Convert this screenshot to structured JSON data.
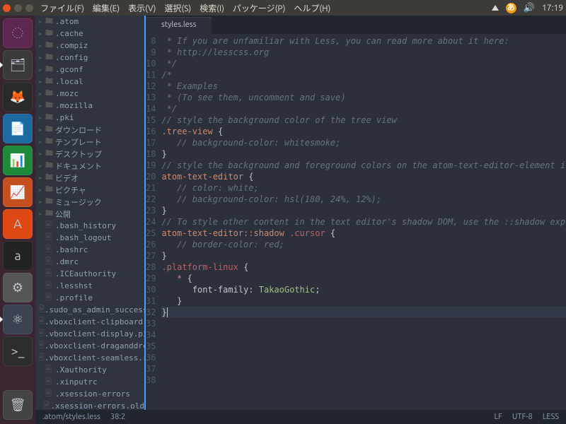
{
  "topbar": {
    "menu": [
      "ファイル(F)",
      "編集(E)",
      "表示(V)",
      "選択(S)",
      "検索(I)",
      "パッケージ(P)",
      "ヘルプ(H)"
    ],
    "input_badge": "あ",
    "time": "17:19"
  },
  "launcher": [
    {
      "name": "dash",
      "bg": "#5e2750",
      "glyph": "◌",
      "active": false
    },
    {
      "name": "files",
      "bg": "#3a3a3a",
      "glyph": "🗂",
      "active": true
    },
    {
      "name": "firefox",
      "bg": "#2a2a2a",
      "glyph": "🦊",
      "active": false
    },
    {
      "name": "writer",
      "bg": "#1c6aa0",
      "glyph": "📄",
      "active": false
    },
    {
      "name": "calc",
      "bg": "#1d8a3a",
      "glyph": "📊",
      "active": false
    },
    {
      "name": "impress",
      "bg": "#c54f1e",
      "glyph": "📈",
      "active": false
    },
    {
      "name": "software",
      "bg": "#dd4814",
      "glyph": "A",
      "active": false
    },
    {
      "name": "amazon",
      "bg": "#222",
      "glyph": "a",
      "active": false
    },
    {
      "name": "settings",
      "bg": "#555",
      "glyph": "⚙",
      "active": false
    },
    {
      "name": "atom",
      "bg": "#3b4252",
      "glyph": "⚛",
      "active": true
    },
    {
      "name": "terminal",
      "bg": "#2c2c2c",
      "glyph": ">_",
      "active": false
    }
  ],
  "tree": {
    "folders": [
      ".atom",
      ".cache",
      ".compiz",
      ".config",
      ".gconf",
      ".local",
      ".mozc",
      ".mozilla",
      ".pki",
      "ダウンロード",
      "テンプレート",
      "デスクトップ",
      "ドキュメント",
      "ビデオ",
      "ピクチャ",
      "ミュージック",
      "公開"
    ],
    "files": [
      ".bash_history",
      ".bash_logout",
      ".bashrc",
      ".dmrc",
      ".ICEauthority",
      ".lesshst",
      ".profile",
      ".sudo_as_admin_success",
      ".vboxclient-clipboard.",
      ".vboxclient-display.pi",
      ".vboxclient-draganddrc",
      ".vboxclient-seamless.r",
      ".Xauthority",
      ".xinputrc",
      ".xsession-errors",
      ".xsession-errors.old"
    ]
  },
  "tab": {
    "label": "styles.less"
  },
  "gutter_start": 8,
  "code_lines": [
    {
      "cls": "c-comment",
      "text": " * If you are unfamiliar with Less, you can read more about it here:"
    },
    {
      "cls": "c-comment",
      "text": " * http://lesscss.org"
    },
    {
      "cls": "c-comment",
      "text": " */"
    },
    {
      "cls": "",
      "text": ""
    },
    {
      "cls": "c-comment",
      "text": "/*"
    },
    {
      "cls": "c-comment",
      "text": " * Examples"
    },
    {
      "cls": "c-comment",
      "text": " * (To see them, uncomment and save)"
    },
    {
      "cls": "c-comment",
      "text": " */"
    },
    {
      "cls": "",
      "text": ""
    },
    {
      "cls": "c-comment",
      "text": "// style the background color of the tree view"
    },
    {
      "html": "<span class='c-sel'>.tree-view</span> <span class='c-brace'>{</span>"
    },
    {
      "cls": "c-comment",
      "text": "   // background-color: whitesmoke;"
    },
    {
      "cls": "c-brace",
      "text": "}"
    },
    {
      "cls": "",
      "text": ""
    },
    {
      "cls": "c-comment",
      "text": "// style the background and foreground colors on the atom-text-editor-element itself"
    },
    {
      "html": "<span class='c-sel'>atom-text-editor</span> <span class='c-brace'>{</span>"
    },
    {
      "cls": "c-comment",
      "text": "   // color: white;"
    },
    {
      "cls": "c-comment",
      "text": "   // background-color: hsl(180, 24%, 12%);"
    },
    {
      "cls": "c-brace",
      "text": "}"
    },
    {
      "cls": "",
      "text": ""
    },
    {
      "cls": "c-comment",
      "text": "// To style other content in the text editor's shadow DOM, use the ::shadow expression"
    },
    {
      "html": "<span class='c-sel'>atom-text-editor</span><span class='c-pseudo'>::shadow</span> <span class='c-class'>.cursor</span> <span class='c-brace'>{</span>"
    },
    {
      "cls": "c-comment",
      "text": "   // border-color: red;"
    },
    {
      "cls": "c-brace",
      "text": "}"
    },
    {
      "cls": "",
      "text": ""
    },
    {
      "html": "<span class='c-class'>.platform-linux</span> <span class='c-brace'>{</span>"
    },
    {
      "html": "   <span class='c-sel'>*</span> <span class='c-brace'>{</span>"
    },
    {
      "html": "      <span class='c-prop'>font-family</span>: <span class='c-val'>TakaoGothic</span>;"
    },
    {
      "cls": "c-brace",
      "text": "   }"
    },
    {
      "cls": "c-brace",
      "text": "}",
      "hl": true,
      "cursor": true
    },
    {
      "cls": "",
      "text": ""
    }
  ],
  "status": {
    "path": ".atom/styles.less",
    "pos": "38:2",
    "lf": "LF",
    "enc": "UTF-8",
    "lang": "LESS"
  }
}
